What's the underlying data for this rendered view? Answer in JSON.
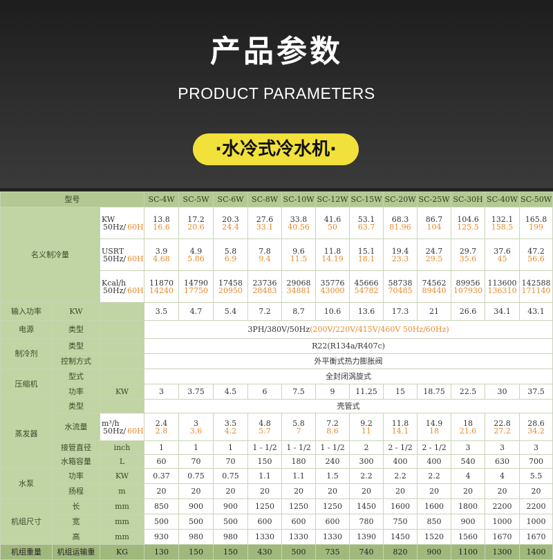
{
  "header": {
    "title_cn": "产品参数",
    "title_en": "PRODUCT PARAMETERS",
    "badge": "·水冷式冷水机·"
  },
  "colors": {
    "band": "#c1d4a4",
    "header_row": "#b3c893",
    "accent": "#e8892c",
    "badge": "#f2e13a"
  },
  "models": [
    "SC-4W",
    "SC-5W",
    "SC-6W",
    "SC-8W",
    "SC-10W",
    "SC-12W",
    "SC-15W",
    "SC-20W",
    "SC-25W",
    "SC-30H",
    "SC-40W",
    "SC-50W"
  ],
  "labels": {
    "model": "型号",
    "rated_cooling": "名义制冷量",
    "input_power": "输入功率",
    "power_supply": "电源",
    "refrigerant": "制冷剂",
    "compressor": "压缩机",
    "evaporator": "蒸发器",
    "pump": "水泵",
    "dimensions": "机组尺寸",
    "weight": "机组重量",
    "type": "类型",
    "control": "控制方式",
    "form": "型式",
    "power": "功率",
    "flow": "水流量",
    "pipe": "接管直径",
    "tank": "水箱容量",
    "head": "扬程",
    "length": "长",
    "width": "宽",
    "height": "高",
    "ship_weight": "机组运输重"
  },
  "units": {
    "kw": "KW",
    "hz": "50Hz/",
    "hz_alt": "60Hz",
    "usrt": "USRT",
    "kcal": "Kcal/h",
    "flow": "m³/h",
    "inch": "inch",
    "l": "L",
    "m": "m",
    "mm": "mm",
    "kg": "KG"
  },
  "rows": {
    "kw_50": [
      "13.8",
      "17.2",
      "20.3",
      "27.6",
      "33.8",
      "41.6",
      "53.1",
      "68.3",
      "86.7",
      "104.6",
      "132.1",
      "165.8"
    ],
    "kw_60": [
      "16.6",
      "20.6",
      "24.4",
      "33.1",
      "40.56",
      "50",
      "63.7",
      "81.96",
      "104",
      "125.5",
      "158.5",
      "199"
    ],
    "usrt_50": [
      "3.9",
      "4.9",
      "5.8",
      "7.8",
      "9.6",
      "11.8",
      "15.1",
      "19.4",
      "24.7",
      "29.7",
      "37.6",
      "47.2"
    ],
    "usrt_60": [
      "4.68",
      "5.86",
      "6.9",
      "9.4",
      "11.5",
      "14.19",
      "18.1",
      "23.3",
      "29.5",
      "35.6",
      "45",
      "56.6"
    ],
    "kcal_50": [
      "11870",
      "14790",
      "17458",
      "23736",
      "29068",
      "35776",
      "45666",
      "58738",
      "74562",
      "89956",
      "113600",
      "142588"
    ],
    "kcal_60": [
      "14240",
      "17750",
      "20950",
      "28483",
      "34881",
      "43000",
      "54782",
      "70485",
      "89440",
      "107930",
      "136310",
      "171140"
    ],
    "input_kw": [
      "3.5",
      "4.7",
      "5.4",
      "7.2",
      "8.7",
      "10.6",
      "13.6",
      "17.3",
      "21",
      "26.6",
      "34.1",
      "43.1"
    ],
    "comp_kw": [
      "3",
      "3.75",
      "4.5",
      "6",
      "7.5",
      "9",
      "11.25",
      "15",
      "18.75",
      "22.5",
      "30",
      "37.5"
    ],
    "flow_50": [
      "2.4",
      "3",
      "3.5",
      "4.8",
      "5.8",
      "7.2",
      "9.2",
      "11.8",
      "14.9",
      "18",
      "22.8",
      "28.6"
    ],
    "flow_60": [
      "2.8",
      "3.6",
      "4.2",
      "5.7",
      "7",
      "8.6",
      "11",
      "14.1",
      "18",
      "21.6",
      "27.2",
      "34.2"
    ],
    "pipe": [
      "1",
      "1",
      "1",
      "1 - 1/2",
      "1 - 1/2",
      "1 - 1/2",
      "2",
      "2 - 1/2",
      "2 - 1/2",
      "3",
      "3",
      "3"
    ],
    "tank": [
      "60",
      "70",
      "70",
      "150",
      "180",
      "240",
      "300",
      "400",
      "400",
      "540",
      "630",
      "700"
    ],
    "pump_kw": [
      "0.37",
      "0.75",
      "0.75",
      "1.1",
      "1.1",
      "1.5",
      "2.2",
      "2.2",
      "2.2",
      "4",
      "4",
      "5.5"
    ],
    "pump_head": [
      "20",
      "20",
      "20",
      "20",
      "20",
      "20",
      "20",
      "20",
      "20",
      "20",
      "20",
      "20"
    ],
    "len": [
      "850",
      "900",
      "900",
      "1250",
      "1250",
      "1250",
      "1450",
      "1600",
      "1600",
      "1800",
      "2200",
      "2200"
    ],
    "wid": [
      "500",
      "500",
      "500",
      "600",
      "600",
      "600",
      "780",
      "750",
      "850",
      "900",
      "1000",
      "1000"
    ],
    "hgt": [
      "930",
      "980",
      "980",
      "1330",
      "1330",
      "1330",
      "1390",
      "1450",
      "1520",
      "1560",
      "1670",
      "1670"
    ],
    "weight": [
      "130",
      "150",
      "150",
      "430",
      "500",
      "735",
      "740",
      "820",
      "900",
      "1100",
      "1300",
      "1400"
    ]
  },
  "spans": {
    "power_main": "3PH/380V/50Hz",
    "power_alt": "(200V/220V/415V/460V  50Hz/60Hz)",
    "refrigerant": "R22(R134a/R407c)",
    "control": "外平衡式热力膨胀阀",
    "compressor_form": "全封闭涡旋式",
    "evap_type": "壳管式"
  }
}
